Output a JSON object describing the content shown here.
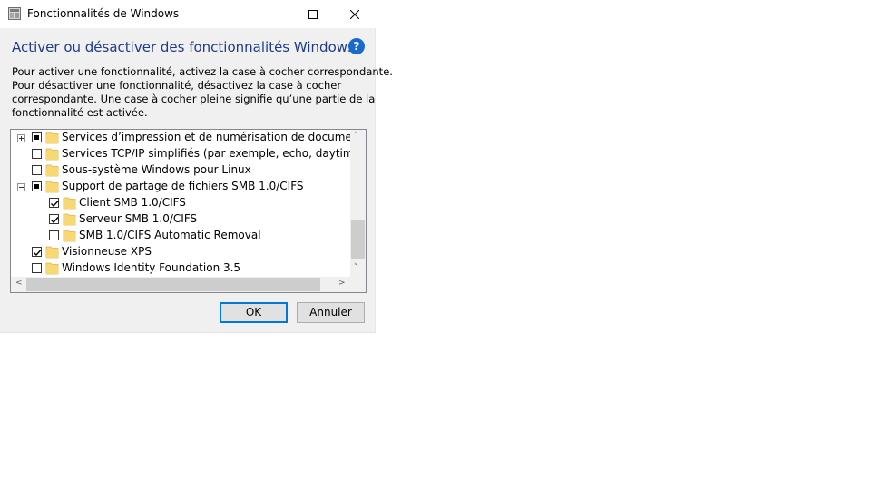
{
  "window": {
    "title": "Fonctionnalités de Windows",
    "controls": {
      "minimize": "—",
      "maximize": "☐",
      "close": "✕"
    }
  },
  "header": {
    "heading": "Activer ou désactiver des fonctionnalités Windows",
    "help_icon": "?"
  },
  "description": [
    "Pour activer une fonctionnalité, activez la case à cocher correspondante.",
    "Pour désactiver une fonctionnalité, désactivez la case à cocher",
    "correspondante. Une case à cocher pleine signifie qu’une partie de la",
    "fonctionnalité est activée."
  ],
  "features": [
    {
      "label": "Services d’impression et de numérisation de document",
      "state": "partial",
      "expander": "plus",
      "level": 0
    },
    {
      "label": "Services TCP/IP simplifiés (par exemple, echo, daytime, etc.)",
      "state": "unchecked",
      "expander": "none",
      "level": 0
    },
    {
      "label": "Sous-système Windows pour Linux",
      "state": "unchecked",
      "expander": "none",
      "level": 0
    },
    {
      "label": "Support de partage de fichiers SMB 1.0/CIFS",
      "state": "partial",
      "expander": "minus",
      "level": 0
    },
    {
      "label": "Client SMB 1.0/CIFS",
      "state": "checked",
      "expander": "none",
      "level": 1
    },
    {
      "label": "Serveur SMB 1.0/CIFS",
      "state": "checked",
      "expander": "none",
      "level": 1
    },
    {
      "label": "SMB 1.0/CIFS Automatic Removal",
      "state": "unchecked",
      "expander": "none",
      "level": 1
    },
    {
      "label": "Visionneuse XPS",
      "state": "checked",
      "expander": "none",
      "level": 0
    },
    {
      "label": "Windows Identity Foundation 3.5",
      "state": "unchecked",
      "expander": "none",
      "level": 0
    }
  ],
  "buttons": {
    "ok": "OK",
    "cancel": "Annuler"
  },
  "colors": {
    "heading": "#1e3c8c",
    "help": "#1b6ac9",
    "folder": "#f8d775",
    "default_border": "#0078d7"
  }
}
